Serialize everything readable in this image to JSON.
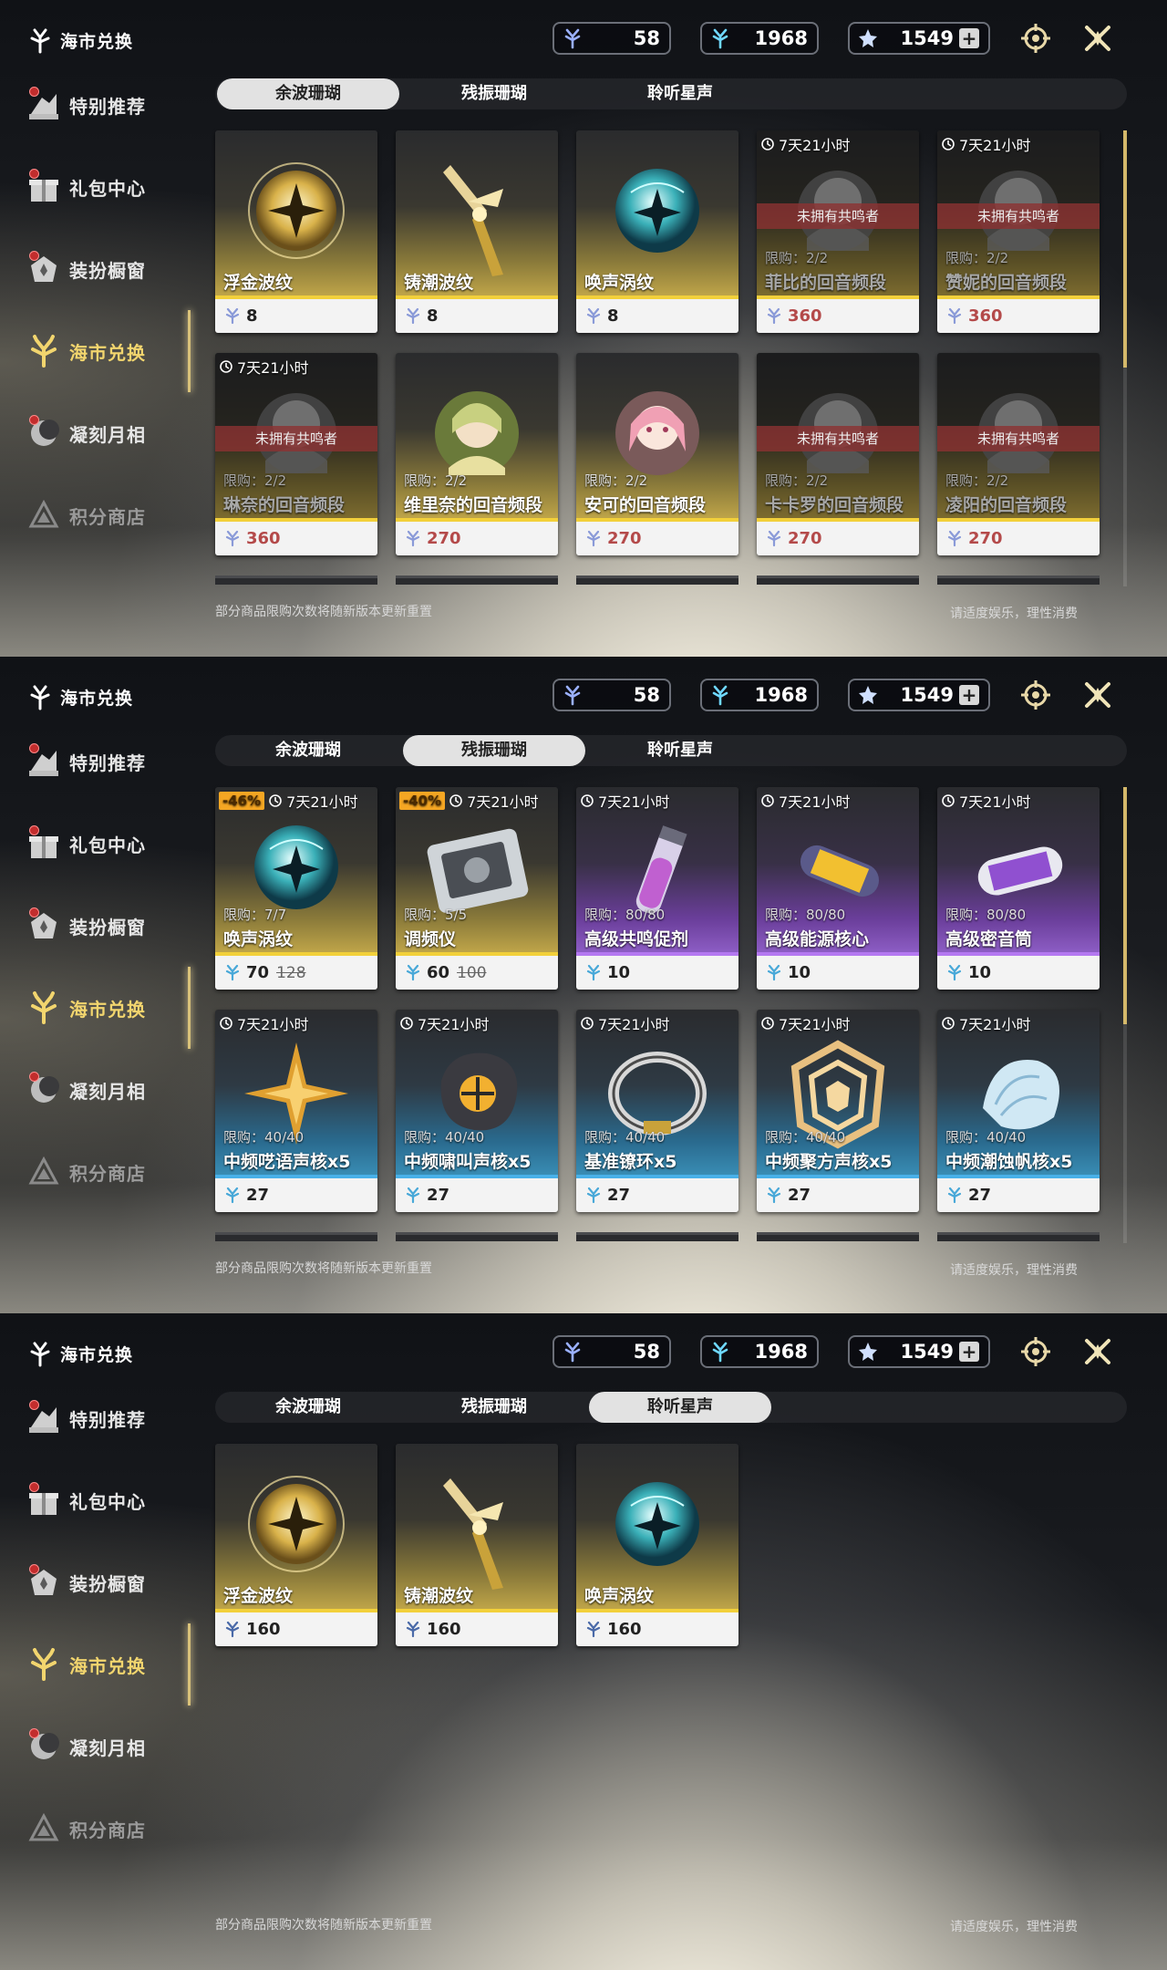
{
  "app_title": "海市兑换",
  "currencies": [
    {
      "name": "coral-afterglow",
      "value": "58"
    },
    {
      "name": "coral-oscillated",
      "value": "1968"
    },
    {
      "name": "astrite-star",
      "value": "1549"
    }
  ],
  "sidebar": {
    "items": [
      {
        "label": "特别推荐",
        "icon": "recommend-icon"
      },
      {
        "label": "礼包中心",
        "icon": "gift-icon"
      },
      {
        "label": "装扮橱窗",
        "icon": "wardrobe-icon"
      },
      {
        "label": "海市兑换",
        "icon": "coral-exchange-icon"
      },
      {
        "label": "凝刻月相",
        "icon": "lunar-icon"
      },
      {
        "label": "积分商店",
        "icon": "points-shop-icon"
      }
    ]
  },
  "tabs": [
    "余波珊瑚",
    "残振珊瑚",
    "聆听星声"
  ],
  "footnote": "部分商品限购次数将随新版本更新重置",
  "footnote_right": "请适度娱乐，理性消费",
  "locked_text": "未拥有共鸣者",
  "timer_text": "7天21小时",
  "panels": [
    {
      "selected_tab": 0,
      "items": [
        {
          "name": "浮金波纹",
          "price": "8",
          "color": "gold",
          "art": "gold-orb"
        },
        {
          "name": "铸潮波纹",
          "price": "8",
          "color": "gold",
          "art": "gold-blade"
        },
        {
          "name": "唤声涡纹",
          "price": "8",
          "color": "gold",
          "art": "teal-orb"
        },
        {
          "name": "菲比的回音频段",
          "price": "360",
          "color": "gold",
          "art": "portrait",
          "locked": true,
          "limit": "限购：2/2",
          "timer": true
        },
        {
          "name": "赞妮的回音频段",
          "price": "360",
          "color": "gold",
          "art": "portrait",
          "locked": true,
          "limit": "限购：2/2",
          "timer": true
        },
        {
          "name": "琳奈的回音频段",
          "price": "360",
          "color": "gold",
          "art": "portrait",
          "locked": true,
          "limit": "限购：2/2",
          "timer": true
        },
        {
          "name": "维里奈的回音频段",
          "price": "270",
          "color": "gold",
          "art": "portrait-green",
          "limit": "限购：2/2"
        },
        {
          "name": "安可的回音频段",
          "price": "270",
          "color": "gold",
          "art": "portrait-pink",
          "limit": "限购：2/2"
        },
        {
          "name": "卡卡罗的回音频段",
          "price": "270",
          "color": "gold",
          "art": "portrait",
          "locked": true,
          "limit": "限购：2/2"
        },
        {
          "name": "凌阳的回音频段",
          "price": "270",
          "color": "gold",
          "art": "portrait",
          "locked": true,
          "limit": "限购：2/2"
        }
      ]
    },
    {
      "selected_tab": 1,
      "items": [
        {
          "name": "唤声涡纹",
          "price": "70",
          "old_price": "128",
          "discount": "-46%",
          "color": "gold",
          "art": "teal-orb",
          "limit": "限购：7/7",
          "timer": true
        },
        {
          "name": "调频仪",
          "price": "60",
          "old_price": "100",
          "discount": "-40%",
          "color": "gold",
          "art": "device",
          "limit": "限购：5/5",
          "timer": true
        },
        {
          "name": "高级共鸣促剂",
          "price": "10",
          "color": "purple",
          "art": "vial",
          "limit": "限购：80/80",
          "timer": true
        },
        {
          "name": "高级能源核心",
          "price": "10",
          "color": "purple",
          "art": "capsule",
          "limit": "限购：80/80",
          "timer": true
        },
        {
          "name": "高级密音筒",
          "price": "10",
          "color": "purple",
          "art": "cylinder",
          "limit": "限购：80/80",
          "timer": true
        },
        {
          "name": "中频呓语声核x5",
          "price": "27",
          "color": "blue",
          "art": "star",
          "limit": "限购：40/40",
          "timer": true
        },
        {
          "name": "中频啸叫声核x5",
          "price": "27",
          "color": "blue",
          "art": "dark-core",
          "limit": "限购：40/40",
          "timer": true
        },
        {
          "name": "基准镣环x5",
          "price": "27",
          "color": "blue",
          "art": "ring",
          "limit": "限购：40/40",
          "timer": true
        },
        {
          "name": "中频聚方声核x5",
          "price": "27",
          "color": "blue",
          "art": "polygon",
          "limit": "限购：40/40",
          "timer": true
        },
        {
          "name": "中频潮蚀帆核x5",
          "price": "27",
          "color": "blue",
          "art": "shell",
          "limit": "限购：40/40",
          "timer": true
        }
      ]
    },
    {
      "selected_tab": 2,
      "items": [
        {
          "name": "浮金波纹",
          "price": "160",
          "color": "gold",
          "art": "gold-orb"
        },
        {
          "name": "铸潮波纹",
          "price": "160",
          "color": "gold",
          "art": "gold-blade"
        },
        {
          "name": "唤声涡纹",
          "price": "160",
          "color": "gold",
          "art": "teal-orb"
        }
      ]
    }
  ],
  "colors": {
    "accent_gold": "#f2d03a",
    "purple": "#b478f0",
    "blue": "#48b0e8",
    "discount": "#f5a623",
    "locked_red": "#8c3232"
  }
}
